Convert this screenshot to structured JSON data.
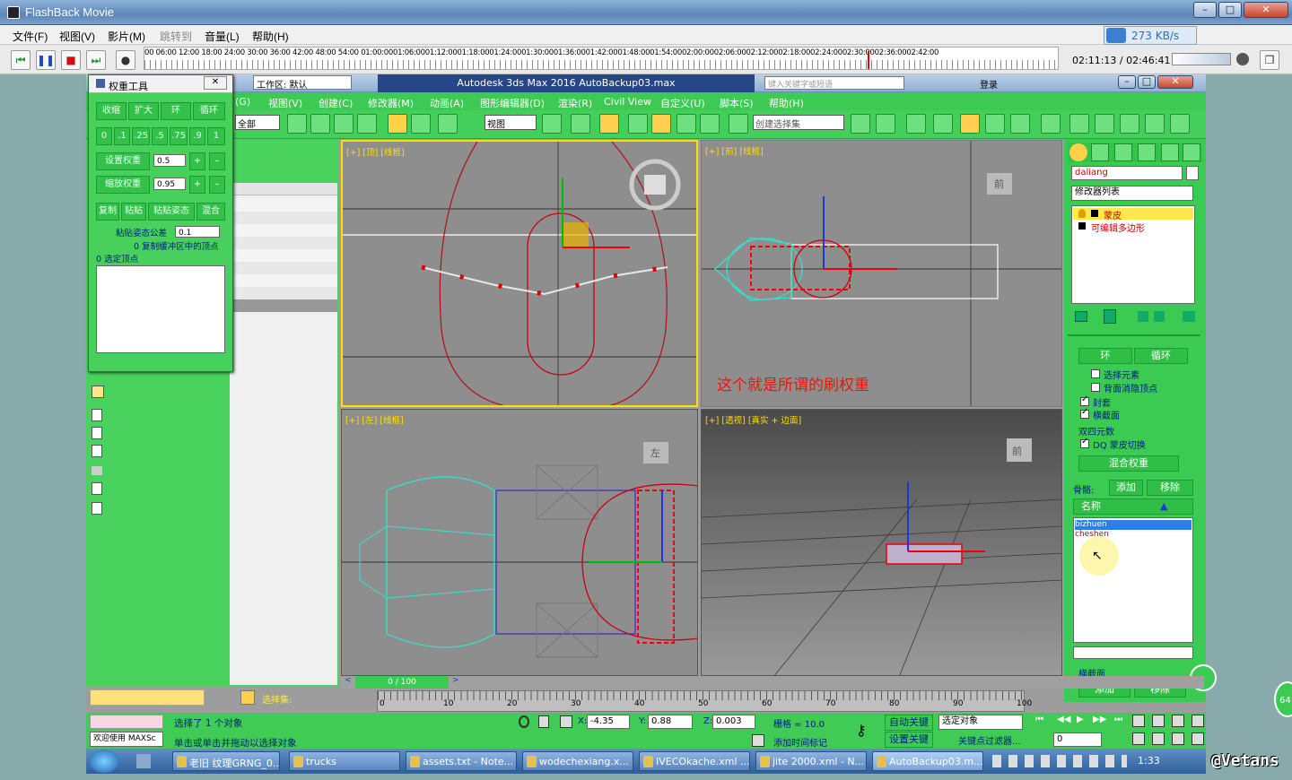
{
  "window": {
    "title": "FlashBack Movie",
    "speed": "273 KB/s"
  },
  "menu": [
    "文件(F)",
    "视图(V)",
    "影片(M)",
    "跳转到",
    "音量(L)",
    "帮助(H)"
  ],
  "timeline": {
    "ticks": "00    06:00    12:00    18:00    24:00    30:00    36:00    42:00    48:00    54:00 01:00:0001:06:0001:12:0001:18:0001:24:0001:30:0001:36:0001:42:0001:48:0001:54:0002:00:0002:06:0002:12:0002:18:0002:24:0002:30:0002:36:0002:42:00",
    "readout": "02:11:13 / 02:46:41"
  },
  "max": {
    "workspace": "工作区: 默认",
    "title": "Autodesk 3ds Max 2016    AutoBackup03.max",
    "search_placeholder": "键入关键字或短语",
    "login": "登录",
    "menus": [
      "(G)",
      "视图(V)",
      "创建(C)",
      "修改器(M)",
      "动画(A)",
      "图形编辑器(D)",
      "渲染(R)",
      "Civil View",
      "自定义(U)",
      "脚本(S)",
      "帮助(H)"
    ],
    "view_dropdown": "视图",
    "selection_set": "创建选择集",
    "layer_dropdown": "全部"
  },
  "viewports": [
    {
      "label": "[+] [顶] [线框]",
      "cube": ""
    },
    {
      "label": "[+] [前] [线框]",
      "cube": "前",
      "annotation": "这个就是所谓的刷权重"
    },
    {
      "label": "[+] [左] [线框]",
      "cube": "左"
    },
    {
      "label": "[+] [透视] [真实 + 边面]",
      "cube": "前"
    }
  ],
  "weight_tool": {
    "title": "权重工具",
    "row1": [
      "收缩",
      "扩大",
      "环",
      "循环"
    ],
    "row2": [
      "0",
      ".1",
      ".25",
      ".5",
      ".75",
      ".9",
      "1"
    ],
    "set_weight": "设置权重",
    "set_weight_val": "0.5",
    "scale_weight": "缩放权重",
    "scale_weight_val": "0.95",
    "row5": [
      "复制",
      "粘贴",
      "粘贴姿态",
      "混合"
    ],
    "paste_tol_label": "粘贴姿态公差",
    "paste_tol_val": "0.1",
    "copy_buffer": "0 复制缓冲区中的顶点",
    "selected_verts": "0 选定顶点"
  },
  "right_panel": {
    "object_name": "daliang",
    "modifier_list": "修改器列表",
    "stack": [
      "蒙皮",
      "可编辑多边形"
    ],
    "ring": "环",
    "loop": "循环",
    "opts": [
      {
        "label": "选择元素",
        "checked": false
      },
      {
        "label": "背面消隐顶点",
        "checked": false
      },
      {
        "label": "封套",
        "checked": true
      },
      {
        "label": "横截面",
        "checked": true
      }
    ],
    "dq_group": "双四元数",
    "dq_toggle": "DQ 蒙皮切换",
    "blend_weights": "混合权重",
    "bones_label": "骨骼:",
    "add": "添加",
    "remove": "移除",
    "name_header": "名称",
    "bones": [
      "bizhuen",
      "cheshen"
    ],
    "cross_section": "横截面",
    "cs_add": "添加",
    "cs_remove": "移除"
  },
  "timeslider": {
    "value": "0 / 100",
    "ticks": [
      "0",
      "10",
      "20",
      "30",
      "40",
      "50",
      "60",
      "70",
      "80",
      "90",
      "100"
    ]
  },
  "status": {
    "selected": "选择了 1 个对象",
    "hint": "单击或单击并拖动以选择对象",
    "welcome": "欢迎使用  MAXSc",
    "x": "-4.35",
    "y": "0.88",
    "z": "0.003",
    "grid": "栅格 = 10.0",
    "auto_key": "自动关键点",
    "selected_obj": "选定对象",
    "set_key": "设置关键点",
    "key_filters": "关键点过滤器...",
    "add_time_tag": "添加时间标记",
    "frame": "0",
    "selection_set_label": "选择集:"
  },
  "taskbar": {
    "items": [
      "老旧 纹理GRNG_0...",
      "trucks",
      "assets.txt - Note...",
      "wodechexiang.x...",
      "IVECOkache.xml ...",
      "jite 2000.xml - N...",
      "AutoBackup03.m..."
    ],
    "clock": "1:33"
  },
  "watermark": "@Vetans",
  "circle_badge": "64"
}
